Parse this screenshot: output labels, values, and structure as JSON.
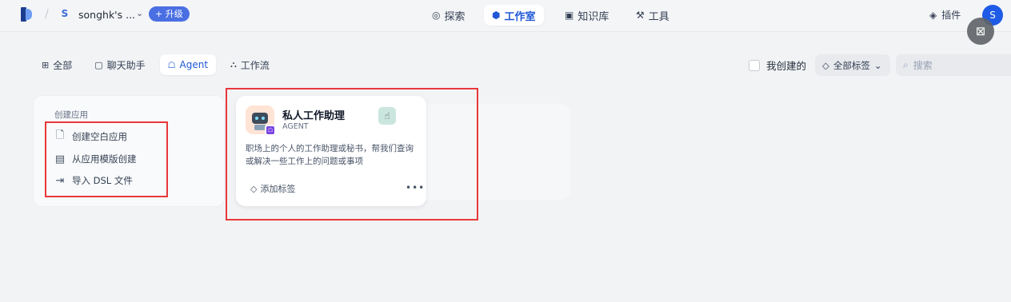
{
  "header": {
    "workspace_initial": "S",
    "workspace_name": "songhk's ...",
    "upgrade_label": "+ 升级",
    "nav": [
      {
        "label": "探索",
        "icon": "compass-icon"
      },
      {
        "label": "工作室",
        "icon": "robot-icon",
        "active": true
      },
      {
        "label": "知识库",
        "icon": "book-icon"
      },
      {
        "label": "工具",
        "icon": "wrench-icon"
      }
    ],
    "plugin_label": "插件",
    "avatar_letter": "S"
  },
  "tabs": [
    {
      "label": "全部",
      "icon": "grid-icon"
    },
    {
      "label": "聊天助手",
      "icon": "chat-icon"
    },
    {
      "label": "Agent",
      "icon": "agent-icon",
      "active": true
    },
    {
      "label": "工作流",
      "icon": "workflow-icon"
    }
  ],
  "filters": {
    "my_created_label": "我创建的",
    "tags_label": "全部标签",
    "search_placeholder": "搜索"
  },
  "create_card": {
    "title": "创建应用",
    "items": [
      {
        "label": "创建空白应用",
        "icon": "file-plus-icon"
      },
      {
        "label": "从应用模版创建",
        "icon": "template-icon"
      },
      {
        "label": "导入 DSL 文件",
        "icon": "import-icon"
      }
    ]
  },
  "app_card": {
    "name": "私人工作助理",
    "type": "AGENT",
    "description": "职场上的个人的工作助理或秘书，帮我们查询或解决一些工作上的问题或事项",
    "add_tag_label": "添加标签",
    "more_label": "•••"
  },
  "colors": {
    "accent": "#1f57d6",
    "annotation_red": "#e8383b"
  }
}
